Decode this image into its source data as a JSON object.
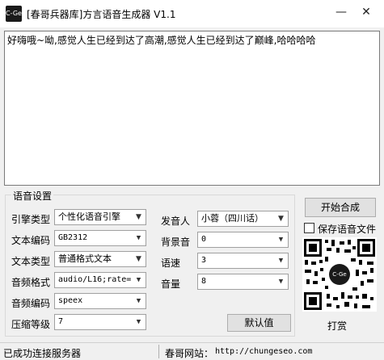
{
  "window": {
    "title": "[春哥兵器库]方言语音生成器 V1.1",
    "app_icon_text": "C-Ge",
    "minimize_label": "—",
    "close_label": "✕"
  },
  "main_text": "好嗨哦~呦,感觉人生已经到达了高潮,感觉人生已经到达了巅峰,哈哈哈哈",
  "settings": {
    "group_title": "语音设置",
    "engine_type": {
      "label": "引擎类型",
      "value": "个性化语音引擎"
    },
    "text_encoding": {
      "label": "文本编码",
      "value": "GB2312"
    },
    "text_type": {
      "label": "文本类型",
      "value": "普通格式文本"
    },
    "audio_format": {
      "label": "音频格式",
      "value": "audio/L16;rate="
    },
    "audio_encoding": {
      "label": "音频编码",
      "value": "speex"
    },
    "compression_level": {
      "label": "压缩等级",
      "value": "7"
    },
    "speaker": {
      "label": "发音人",
      "value": "小蓉（四川话）"
    },
    "background_sound": {
      "label": "背景音",
      "value": "0"
    },
    "speed": {
      "label": "语速",
      "value": "3"
    },
    "volume": {
      "label": "音量",
      "value": "8"
    },
    "default_button": "默认值"
  },
  "actions": {
    "start_button": "开始合成",
    "save_checkbox_label": "保存语音文件",
    "save_checked": false,
    "qr_center_text": "C-Ge",
    "tip_label": "打赏"
  },
  "statusbar": {
    "status": "已成功连接服务器",
    "site_label": "春哥网站：",
    "site_url": "http://chungeseo.com"
  }
}
